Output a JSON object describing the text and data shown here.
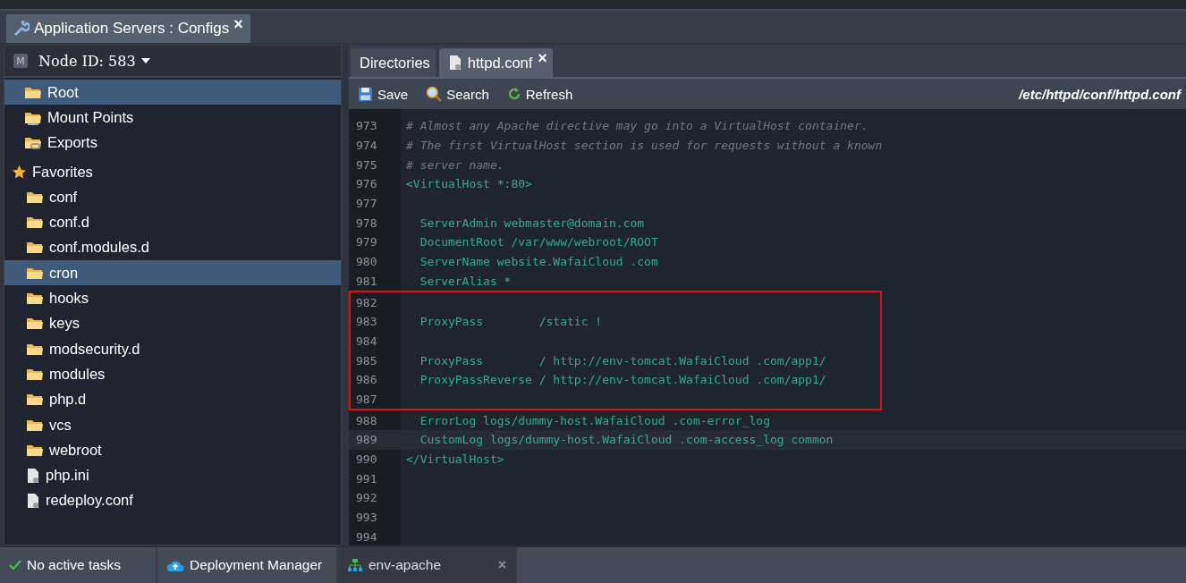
{
  "window_tab": {
    "title": "Application Servers : Configs",
    "close": "×"
  },
  "node_selector": {
    "badge": "M",
    "label": "Node ID: 583"
  },
  "tree": [
    {
      "label": "Root",
      "kind": "folder",
      "selected": true
    },
    {
      "label": "Mount Points",
      "kind": "mount",
      "selected": false
    },
    {
      "label": "Exports",
      "kind": "export",
      "selected": false
    }
  ],
  "favorites": {
    "label": "Favorites",
    "children": [
      {
        "label": "conf",
        "kind": "folder",
        "selected": false
      },
      {
        "label": "conf.d",
        "kind": "folder",
        "selected": false
      },
      {
        "label": "conf.modules.d",
        "kind": "folder",
        "selected": false
      },
      {
        "label": "cron",
        "kind": "folder",
        "selected": true
      },
      {
        "label": "hooks",
        "kind": "folder",
        "selected": false
      },
      {
        "label": "keys",
        "kind": "folder",
        "selected": false
      },
      {
        "label": "modsecurity.d",
        "kind": "folder",
        "selected": false
      },
      {
        "label": "modules",
        "kind": "folder",
        "selected": false
      },
      {
        "label": "php.d",
        "kind": "folder",
        "selected": false
      },
      {
        "label": "vcs",
        "kind": "folder",
        "selected": false
      },
      {
        "label": "webroot",
        "kind": "folder",
        "selected": false
      },
      {
        "label": "php.ini",
        "kind": "file",
        "selected": false
      },
      {
        "label": "redeploy.conf",
        "kind": "file",
        "selected": false
      }
    ]
  },
  "editor_tabs": [
    {
      "label": "Directories",
      "kind": "plain",
      "selected": false
    },
    {
      "label": "httpd.conf",
      "kind": "file",
      "selected": true,
      "close": "×"
    }
  ],
  "toolbar": {
    "buttons": [
      {
        "label": "Save",
        "kind": "save"
      },
      {
        "label": "Search",
        "kind": "search"
      },
      {
        "label": "Refresh",
        "kind": "refresh"
      }
    ],
    "path": "/etc/httpd/conf/httpd.conf"
  },
  "editor": {
    "blocks": [
      {
        "kind": "plain",
        "lines": [
          {
            "number": "973",
            "text": "# Almost any Apache directive may go into a VirtualHost container.",
            "kind": "comment",
            "selected": false
          },
          {
            "number": "974",
            "text": "# The first VirtualHost section is used for requests without a known",
            "kind": "comment",
            "selected": false
          },
          {
            "number": "975",
            "text": "# server name.",
            "kind": "comment",
            "selected": false
          },
          {
            "number": "976",
            "text": "<VirtualHost *:80>",
            "kind": "code",
            "selected": false
          },
          {
            "number": "977",
            "selected": false
          },
          {
            "number": "978",
            "text": "  ServerAdmin webmaster@domain.com",
            "kind": "code",
            "selected": false
          },
          {
            "number": "979",
            "text": "  DocumentRoot /var/www/webroot/ROOT",
            "kind": "code",
            "selected": false
          },
          {
            "number": "980",
            "text": "  ServerName website.WafaiCloud .com",
            "kind": "code",
            "selected": false
          },
          {
            "number": "981",
            "text": "  ServerAlias *",
            "kind": "code",
            "selected": false
          }
        ]
      },
      {
        "kind": "boxed",
        "lines": [
          {
            "number": "982",
            "selected": false
          },
          {
            "number": "983",
            "text": "  ProxyPass        /static !",
            "kind": "code",
            "selected": false
          },
          {
            "number": "984",
            "selected": false
          },
          {
            "number": "985",
            "text": "  ProxyPass        / http://env-tomcat.WafaiCloud .com/app1/",
            "kind": "code",
            "selected": false
          },
          {
            "number": "986",
            "text": "  ProxyPassReverse / http://env-tomcat.WafaiCloud .com/app1/",
            "kind": "code",
            "selected": false
          },
          {
            "number": "987",
            "selected": false
          }
        ]
      },
      {
        "kind": "plain",
        "lines": [
          {
            "number": "988",
            "text": "  ErrorLog logs/dummy-host.WafaiCloud .com-error_log",
            "kind": "code",
            "selected": false
          },
          {
            "number": "989",
            "text": "  CustomLog logs/dummy-host.WafaiCloud .com-access_log common",
            "kind": "code",
            "selected": true
          },
          {
            "number": "990",
            "text": "</VirtualHost>",
            "kind": "code",
            "selected": false
          },
          {
            "number": "991",
            "selected": false
          },
          {
            "number": "992",
            "selected": false
          },
          {
            "number": "993",
            "selected": false
          },
          {
            "number": "994",
            "selected": false
          }
        ]
      }
    ]
  },
  "taskbar": [
    {
      "label": "No active tasks",
      "kind": "status",
      "selected": false
    },
    {
      "label": "Deployment Manager",
      "kind": "cloud",
      "selected": false
    },
    {
      "label": "env-apache",
      "kind": "env",
      "selected": true,
      "close": "×"
    }
  ]
}
